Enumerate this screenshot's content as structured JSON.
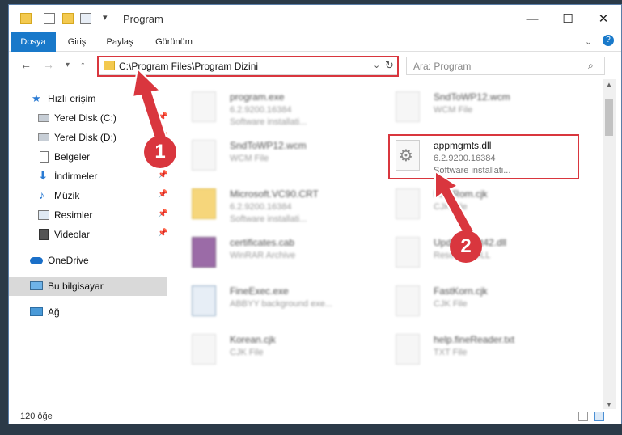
{
  "window": {
    "title": "Program"
  },
  "ribbon": {
    "tabs": [
      "Dosya",
      "Giriş",
      "Paylaş",
      "Görünüm"
    ]
  },
  "address": {
    "path": "C:\\Program Files\\Program Dizini"
  },
  "search": {
    "placeholder": "Ara: Program"
  },
  "sidebar": {
    "quick_access": "Hızlı erişim",
    "items": [
      "Yerel Disk (C:)",
      "Yerel Disk (D:)",
      "Belgeler",
      "İndirmeler",
      "Müzik",
      "Resimler",
      "Videolar"
    ],
    "onedrive": "OneDrive",
    "this_pc": "Bu bilgisayar",
    "network": "Ağ"
  },
  "files": [
    {
      "name": "program.exe",
      "line1": "6.2.9200.16384",
      "line2": "Software installati..."
    },
    {
      "name": "SndToWP12.wcm",
      "line1": "WCM File",
      "line2": ""
    },
    {
      "name": "SndToWP12.wcm",
      "line1": "WCM File",
      "line2": ""
    },
    {
      "name": "appmgmts.dll",
      "line1": "6.2.9200.16384",
      "line2": "Software installati..."
    },
    {
      "name": "Microsoft.VC90.CRT",
      "line1": "6.2.9200.16384",
      "line2": "Software installati..."
    },
    {
      "name": "FineRom.cjk",
      "line1": "CJK File",
      "line2": ""
    },
    {
      "name": "certificates.cab",
      "line1": "WinRAR Archive",
      "line2": ""
    },
    {
      "name": "UpdateCert42.dll",
      "line1": "Resource DLL",
      "line2": ""
    },
    {
      "name": "FineExec.exe",
      "line1": "ABBYY background exe...",
      "line2": ""
    },
    {
      "name": "FastKorn.cjk",
      "line1": "CJK File",
      "line2": ""
    },
    {
      "name": "Korean.cjk",
      "line1": "CJK File",
      "line2": ""
    },
    {
      "name": "help.fineReader.txt",
      "line1": "TXT File",
      "line2": ""
    }
  ],
  "status": {
    "count": "120 öğe"
  },
  "annotations": {
    "badge1": "1",
    "badge2": "2"
  },
  "colors": {
    "accent": "#1979ca",
    "highlight": "#d9363e"
  }
}
